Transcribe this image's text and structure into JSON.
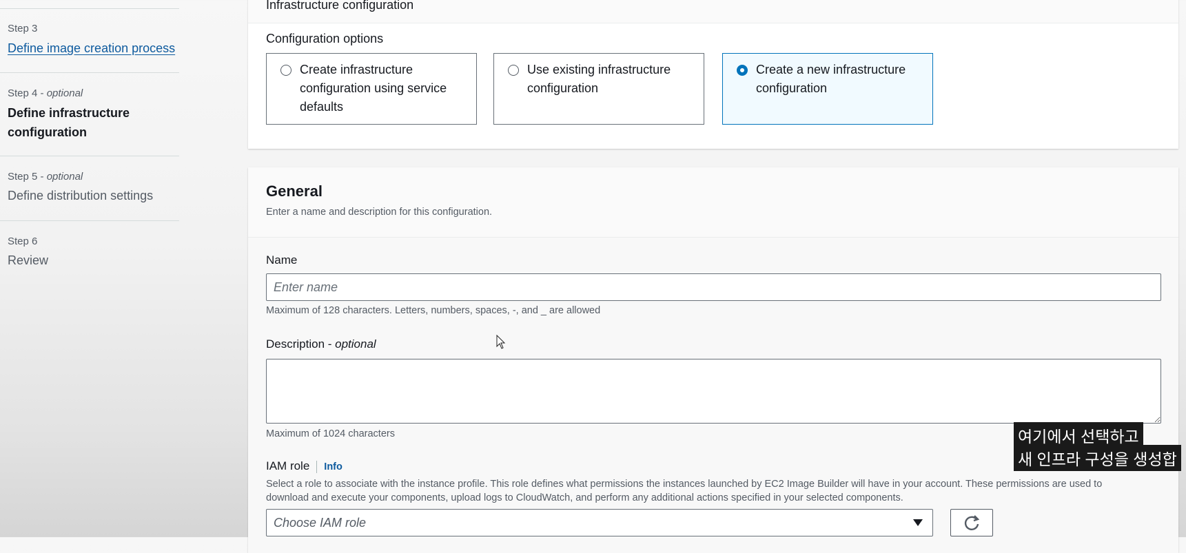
{
  "sidebar": {
    "steps": [
      {
        "caption": "Step 3",
        "optional": "",
        "title": "Define image creation process"
      },
      {
        "caption": "Step 4 - ",
        "optional": "optional",
        "title": "Define infrastructure configuration"
      },
      {
        "caption": "Step 5 - ",
        "optional": "optional",
        "title": "Define distribution settings"
      },
      {
        "caption": "Step 6",
        "optional": "",
        "title": "Review"
      }
    ]
  },
  "infrastructure": {
    "title": "Infrastructure configuration",
    "options_label": "Configuration options",
    "options": [
      {
        "label": "Create infrastructure configuration using service defaults",
        "selected": false
      },
      {
        "label": "Use existing infrastructure configuration",
        "selected": false
      },
      {
        "label": "Create a new infrastructure configuration",
        "selected": true
      }
    ]
  },
  "general": {
    "title": "General",
    "description": "Enter a name and description for this configuration.",
    "name_label": "Name",
    "name_value": "",
    "name_placeholder": "Enter name",
    "name_hint": "Maximum of 128 characters. Letters, numbers, spaces, -, and _ are allowed",
    "desc_label": "Description - ",
    "desc_optional": "optional",
    "desc_value": "",
    "desc_hint": "Maximum of 1024 characters",
    "iam_label": "IAM role",
    "iam_info": "Info",
    "iam_desc_line1": "Select a role to associate with the instance profile. This role defines what permissions the instances launched by EC2 Image Builder will have in your account. These permissions are used to",
    "iam_desc_line2": "download and execute your components, upload logs to CloudWatch, and perform any additional actions specified in your selected components.",
    "iam_select_placeholder": "Choose IAM role"
  },
  "subtitles": {
    "line1": "여기에서 선택하고",
    "line2": "새 인프라 구성을 생성합"
  },
  "icons": {
    "dropdown": "caret-down-icon",
    "refresh": "refresh-icon",
    "cursor": "mouse-pointer-icon"
  },
  "colors": {
    "accent": "#0073bb",
    "link": "#0d5a9e",
    "selected_bg": "#f1faff"
  }
}
